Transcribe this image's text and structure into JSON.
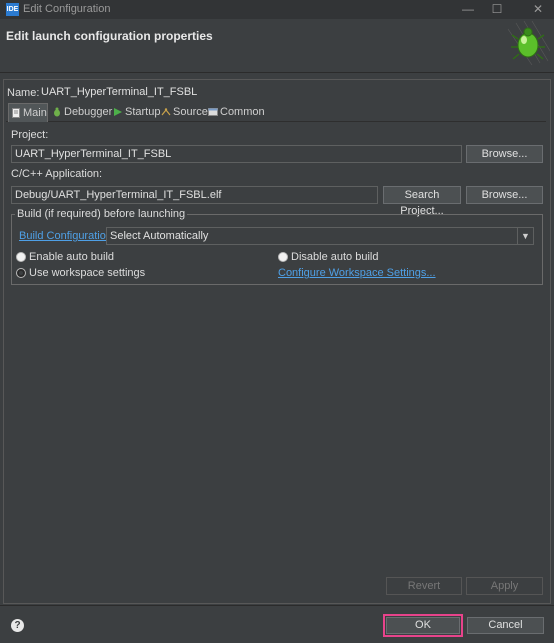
{
  "window": {
    "app_icon_text": "IDE",
    "title": "Edit Configuration",
    "minimize_glyph": "—",
    "maximize_glyph": "☐",
    "close_glyph": "✕"
  },
  "header": {
    "title": "Edit launch configuration properties",
    "logo_icon": "bug-debug-icon"
  },
  "config": {
    "name_label": "Name:",
    "name_value": "UART_HyperTerminal_IT_FSBL"
  },
  "tabs": [
    {
      "label": "Main",
      "icon": "document-icon",
      "active": true
    },
    {
      "label": "Debugger",
      "icon": "debugger-icon",
      "active": false
    },
    {
      "label": "Startup",
      "icon": "play-icon",
      "active": false
    },
    {
      "label": "Source",
      "icon": "source-icon",
      "active": false
    },
    {
      "label": "Common",
      "icon": "common-icon",
      "active": false
    }
  ],
  "main": {
    "project_label": "Project:",
    "project_value": "UART_HyperTerminal_IT_FSBL",
    "project_browse": "Browse...",
    "app_label": "C/C++ Application:",
    "app_value": "Debug/UART_HyperTerminal_IT_FSBL.elf",
    "search_project": "Search Project...",
    "app_browse": "Browse...",
    "build_group": {
      "legend": "Build (if required) before launching",
      "config_link": "Build Configuration:",
      "config_value": "Select Automatically",
      "enable_auto": "Enable auto build",
      "disable_auto": "Disable auto build",
      "use_workspace": "Use workspace settings",
      "configure_link": "Configure Workspace Settings..."
    },
    "selected_option": "Use workspace settings"
  },
  "actions": {
    "revert": "Revert",
    "apply": "Apply"
  },
  "footer": {
    "help_glyph": "?",
    "ok": "OK",
    "cancel": "Cancel"
  },
  "colors": {
    "background": "#3c3f41",
    "link": "#4fa0e6",
    "ok_highlight": "#e8438b"
  }
}
